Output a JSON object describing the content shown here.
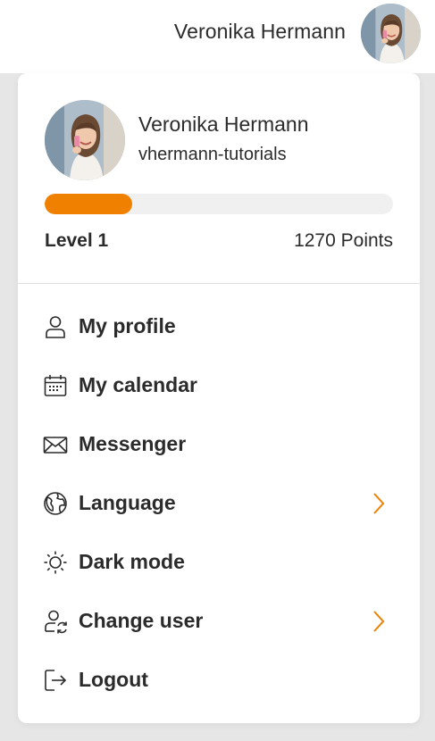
{
  "header": {
    "user_name": "Veronika Hermann"
  },
  "profile": {
    "name": "Veronika Hermann",
    "handle": "vhermann-tutorials",
    "level": "Level 1",
    "points": "1270 Points",
    "progress": 0.25
  },
  "colors": {
    "accent": "#f08000",
    "text": "#2b2b2b",
    "backdrop": "#e6e6e6"
  },
  "menu": {
    "items": [
      {
        "label": "My profile",
        "icon": "user-icon",
        "has_submenu": false
      },
      {
        "label": "My calendar",
        "icon": "calendar-icon",
        "has_submenu": false
      },
      {
        "label": "Messenger",
        "icon": "envelope-icon",
        "has_submenu": false
      },
      {
        "label": "Language",
        "icon": "globe-icon",
        "has_submenu": true
      },
      {
        "label": "Dark mode",
        "icon": "sun-icon",
        "has_submenu": false
      },
      {
        "label": "Change user",
        "icon": "user-switch-icon",
        "has_submenu": true
      },
      {
        "label": "Logout",
        "icon": "logout-icon",
        "has_submenu": false
      }
    ]
  }
}
